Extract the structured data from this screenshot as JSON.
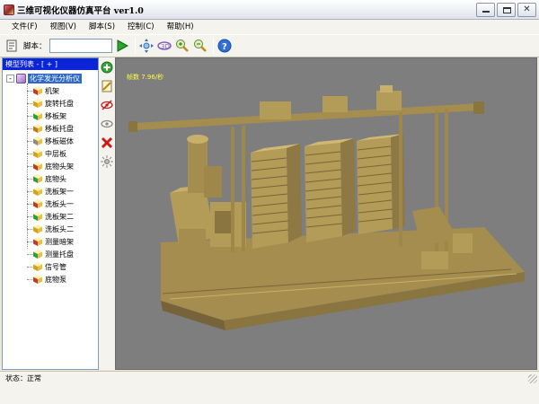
{
  "window": {
    "title": "三维可视化仪器仿真平台 ver1.0",
    "controls": [
      "minimize",
      "maximize",
      "close"
    ]
  },
  "menu": {
    "items": [
      "文件(F)",
      "视图(V)",
      "脚本(S)",
      "控制(C)",
      "帮助(H)"
    ]
  },
  "toolbar": {
    "script_label": "脚本：",
    "script_value": "",
    "icons": [
      "script-icon",
      "play-icon",
      "move-icon",
      "rotate-3d-icon",
      "zoom-in-icon",
      "zoom-out-icon",
      "help-icon"
    ]
  },
  "model_panel": {
    "header": "模型列表 - [ + ]",
    "root": {
      "label": "化学发光分析仪",
      "expander": "-"
    },
    "items": [
      {
        "label": "机架",
        "color": "#c0392b"
      },
      {
        "label": "旋转托盘",
        "color": "#d4a020"
      },
      {
        "label": "移板架",
        "color": "#2e9e3a"
      },
      {
        "label": "移板托盘",
        "color": "#c07820"
      },
      {
        "label": "移板磁体",
        "color": "#8a8a8a"
      },
      {
        "label": "中层板",
        "color": "#d4a020"
      },
      {
        "label": "底物头架",
        "color": "#c0392b"
      },
      {
        "label": "底物头",
        "color": "#2e9e3a"
      },
      {
        "label": "洗板架一",
        "color": "#d4a020"
      },
      {
        "label": "洗板头一",
        "color": "#c0392b"
      },
      {
        "label": "洗板架二",
        "color": "#2e9e3a"
      },
      {
        "label": "洗板头二",
        "color": "#d4a020"
      },
      {
        "label": "测量暗架",
        "color": "#c0392b"
      },
      {
        "label": "测量托盘",
        "color": "#2e9e3a"
      },
      {
        "label": "信号管",
        "color": "#d4a020"
      },
      {
        "label": "底物泵",
        "color": "#c0392b"
      }
    ]
  },
  "side_tools": [
    "add-icon",
    "edit-icon",
    "hide-icon",
    "show-icon",
    "delete-icon",
    "light-icon"
  ],
  "viewport": {
    "fps_text": "帧数  7.96/秒",
    "background": "#7e7e7e",
    "model_color": "#b39b58"
  },
  "status": {
    "text": "状态：正常"
  }
}
